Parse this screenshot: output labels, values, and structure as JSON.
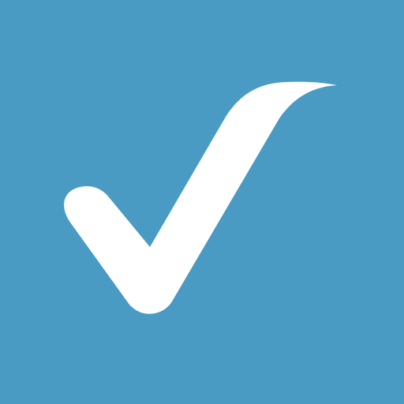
{
  "icon": {
    "name": "checkmark-icon",
    "background_color": "#4a9bc4",
    "glyph_color": "#ffffff"
  }
}
